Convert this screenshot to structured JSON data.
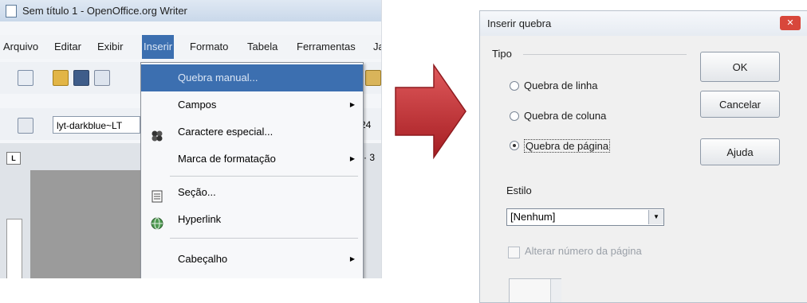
{
  "left_window": {
    "title": "Sem título 1 - OpenOffice.org Writer",
    "menu": [
      "Arquivo",
      "Editar",
      "Exibir",
      "Inserir",
      "Formato",
      "Tabela",
      "Ferramentas",
      "Ja"
    ],
    "active_menu_index": 3,
    "style_box": "lyt-darkblue~LT",
    "font_size": "24",
    "ruler_mark": "· 3",
    "ruler_button": "L"
  },
  "dropdown": {
    "items": [
      {
        "label": "Quebra manual...",
        "icon": "",
        "submenu": false,
        "highlight": true
      },
      {
        "label": "Campos",
        "icon": "",
        "submenu": true,
        "highlight": false
      },
      {
        "label": "Caractere especial...",
        "icon": "omega-icon",
        "submenu": false,
        "highlight": false
      },
      {
        "label": "Marca de formatação",
        "icon": "",
        "submenu": true,
        "highlight": false
      },
      {
        "label": "Seção...",
        "icon": "section-icon",
        "submenu": false,
        "highlight": false
      },
      {
        "label": "Hyperlink",
        "icon": "globe-icon",
        "submenu": false,
        "highlight": false
      },
      {
        "label": "Cabeçalho",
        "icon": "",
        "submenu": true,
        "highlight": false
      }
    ]
  },
  "dialog": {
    "title": "Inserir quebra",
    "close_glyph": "✕",
    "group_tipo": "Tipo",
    "radio_linha": "Quebra de linha",
    "radio_coluna": "Quebra de coluna",
    "radio_pagina": "Quebra de página",
    "selected": "pagina",
    "estilo_label": "Estilo",
    "estilo_value": "[Nenhum]",
    "checkbox_label": "Alterar número da página",
    "checkbox_checked": false,
    "ok": "OK",
    "cancel": "Cancelar",
    "help": "Ajuda"
  },
  "colors": {
    "menu_highlight": "#3c6fb0",
    "arrow": "#c0282b"
  }
}
